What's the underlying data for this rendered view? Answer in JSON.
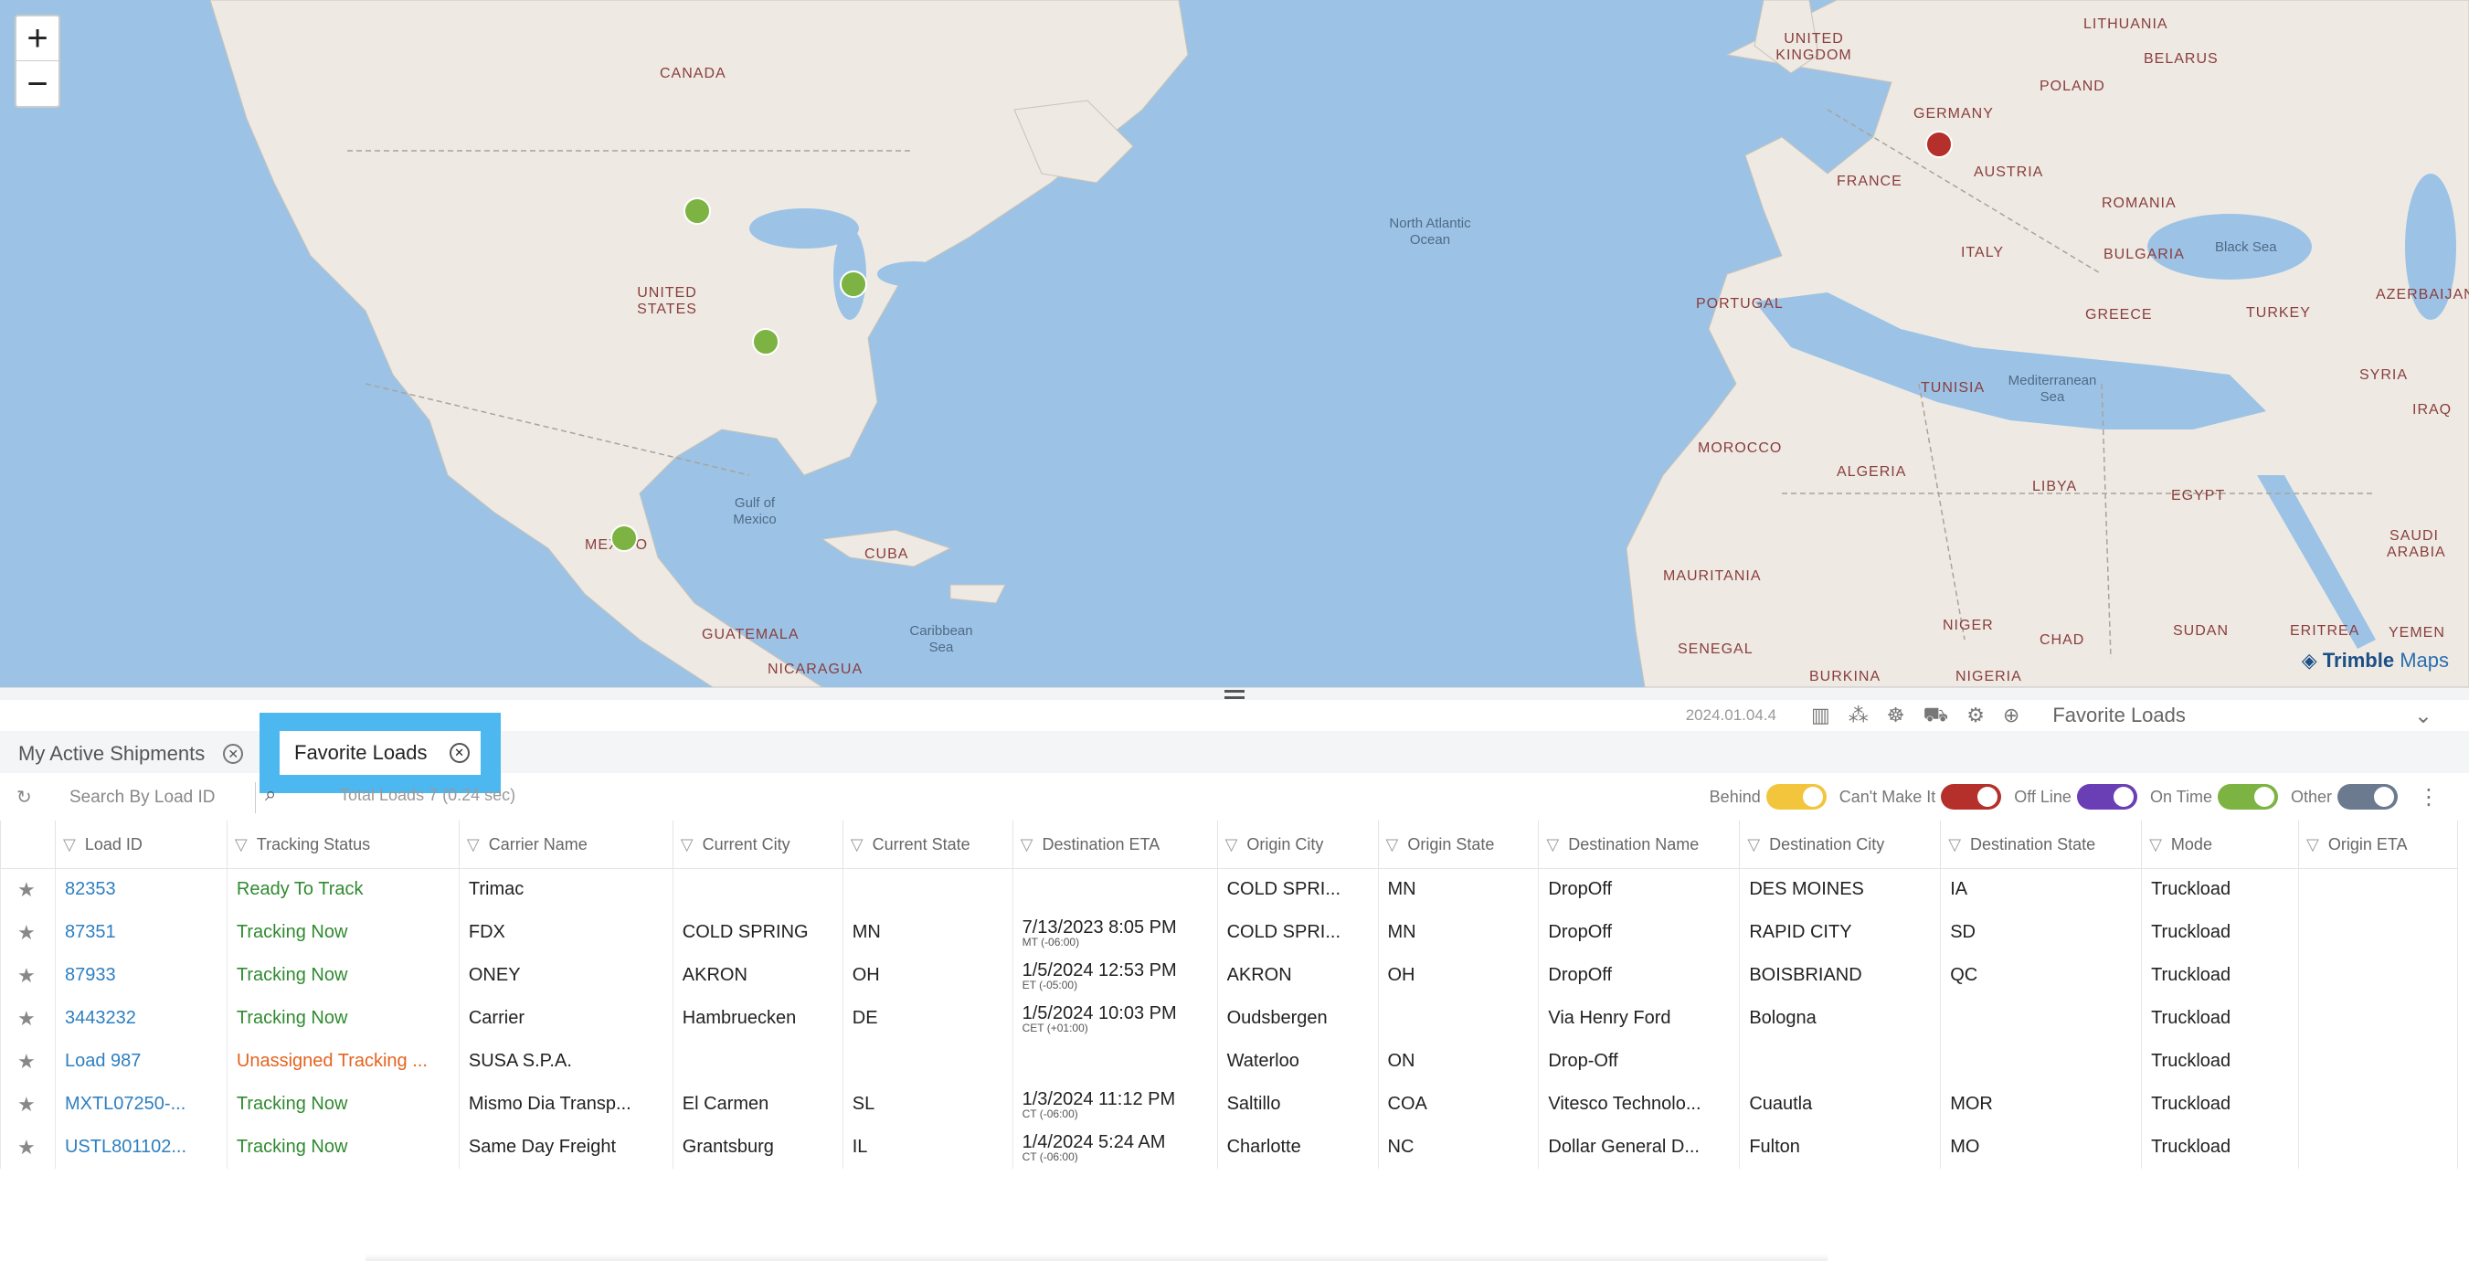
{
  "map": {
    "zoom_in": "+",
    "zoom_out": "−",
    "attribution": {
      "brand": "Trimble",
      "product": "Maps"
    },
    "labels": [
      "CANADA",
      "UNITED STATES",
      "Gulf of Mexico",
      "MEXICO",
      "CUBA",
      "Caribbean Sea",
      "GUATEMALA",
      "NICARAGUA",
      "North Atlantic Ocean",
      "UNITED KINGDOM",
      "LITHUANIA",
      "BELARUS",
      "POLAND",
      "GERMANY",
      "FRANCE",
      "AUSTRIA",
      "ROMANIA",
      "ITALY",
      "BULGARIA",
      "Black Sea",
      "PORTUGAL",
      "GREECE",
      "TURKEY",
      "AZERBAIJAN",
      "TUNISIA",
      "SYRIA",
      "Mediterranean Sea",
      "IRAQ",
      "MOROCCO",
      "ALGERIA",
      "LIBYA",
      "EGYPT",
      "SAUDI ARABIA",
      "MAURITANIA",
      "NIGER",
      "CHAD",
      "SUDAN",
      "ERITREA",
      "SENEGAL",
      "YEMEN",
      "BURKINA",
      "NIGERIA"
    ],
    "pin_colors": {
      "on_time": "#7cb342",
      "cant_make_it": "#b5302a"
    }
  },
  "header": {
    "version": "2024.01.04.4",
    "view_select": "Favorite Loads",
    "icons": [
      "map-icon",
      "cluster-icon",
      "traffic-icon",
      "truck-icon",
      "settings-icon",
      "zoom-icon"
    ]
  },
  "tabs": [
    {
      "label": "My Active Shipments",
      "active": false
    },
    {
      "label": "Favorite Loads",
      "active": true
    }
  ],
  "toolbar": {
    "search_placeholder": "Search By Load ID",
    "total": "Total Loads 7 (0.24 sec)",
    "legend": [
      {
        "label": "Behind",
        "color": "#f2c53d"
      },
      {
        "label": "Can't Make It",
        "color": "#b5302a"
      },
      {
        "label": "Off Line",
        "color": "#6a3fb5"
      },
      {
        "label": "On Time",
        "color": "#7cb342"
      },
      {
        "label": "Other",
        "color": "#6b7a8f"
      }
    ]
  },
  "table": {
    "columns": [
      "Load ID",
      "Tracking Status",
      "Carrier Name",
      "Current City",
      "Current State",
      "Destination ETA",
      "Origin City",
      "Origin State",
      "Destination Name",
      "Destination City",
      "Destination State",
      "Mode",
      "Origin ETA"
    ],
    "rows": [
      {
        "id": "82353",
        "status": "Ready To Track",
        "carrier": "Trimac",
        "cur_city": "",
        "cur_state": "",
        "eta": "",
        "eta_tz": "",
        "orig_city": "COLD SPRI...",
        "orig_state": "MN",
        "dest_name": "DropOff",
        "dest_city": "DES MOINES",
        "dest_state": "IA",
        "mode": "Truckload",
        "orig_eta": ""
      },
      {
        "id": "87351",
        "status": "Tracking Now",
        "carrier": "FDX",
        "cur_city": "COLD SPRING",
        "cur_state": "MN",
        "eta": "7/13/2023  8:05 PM",
        "eta_tz": "MT (-06:00)",
        "orig_city": "COLD SPRI...",
        "orig_state": "MN",
        "dest_name": "DropOff",
        "dest_city": "RAPID CITY",
        "dest_state": "SD",
        "mode": "Truckload",
        "orig_eta": ""
      },
      {
        "id": "87933",
        "status": "Tracking Now",
        "carrier": "ONEY",
        "cur_city": "AKRON",
        "cur_state": "OH",
        "eta": "1/5/2024  12:53 PM",
        "eta_tz": "ET (-05:00)",
        "orig_city": "AKRON",
        "orig_state": "OH",
        "dest_name": "DropOff",
        "dest_city": "BOISBRIAND",
        "dest_state": "QC",
        "mode": "Truckload",
        "orig_eta": ""
      },
      {
        "id": "3443232",
        "status": "Tracking Now",
        "carrier": "Carrier",
        "cur_city": "Hambruecken",
        "cur_state": "DE",
        "eta": "1/5/2024  10:03 PM",
        "eta_tz": "CET (+01:00)",
        "orig_city": "Oudsbergen",
        "orig_state": "",
        "dest_name": "Via Henry Ford",
        "dest_city": "Bologna",
        "dest_state": "",
        "mode": "Truckload",
        "orig_eta": ""
      },
      {
        "id": "Load 987",
        "status": "Unassigned Tracking ...",
        "carrier": "SUSA S.P.A.",
        "cur_city": "",
        "cur_state": "",
        "eta": "",
        "eta_tz": "",
        "orig_city": "Waterloo",
        "orig_state": "ON",
        "dest_name": "Drop-Off",
        "dest_city": "",
        "dest_state": "",
        "mode": "Truckload",
        "orig_eta": ""
      },
      {
        "id": "MXTL07250-...",
        "status": "Tracking Now",
        "carrier": "Mismo Dia Transp...",
        "cur_city": "El Carmen",
        "cur_state": "SL",
        "eta": "1/3/2024  11:12 PM",
        "eta_tz": "CT (-06:00)",
        "orig_city": "Saltillo",
        "orig_state": "COA",
        "dest_name": "Vitesco Technolo...",
        "dest_city": "Cuautla",
        "dest_state": "MOR",
        "mode": "Truckload",
        "orig_eta": ""
      },
      {
        "id": "USTL801102...",
        "status": "Tracking Now",
        "carrier": "Same Day Freight",
        "cur_city": "Grantsburg",
        "cur_state": "IL",
        "eta": "1/4/2024  5:24 AM",
        "eta_tz": "CT (-06:00)",
        "orig_city": "Charlotte",
        "orig_state": "NC",
        "dest_name": "Dollar General D...",
        "dest_city": "Fulton",
        "dest_state": "MO",
        "mode": "Truckload",
        "orig_eta": ""
      }
    ]
  }
}
